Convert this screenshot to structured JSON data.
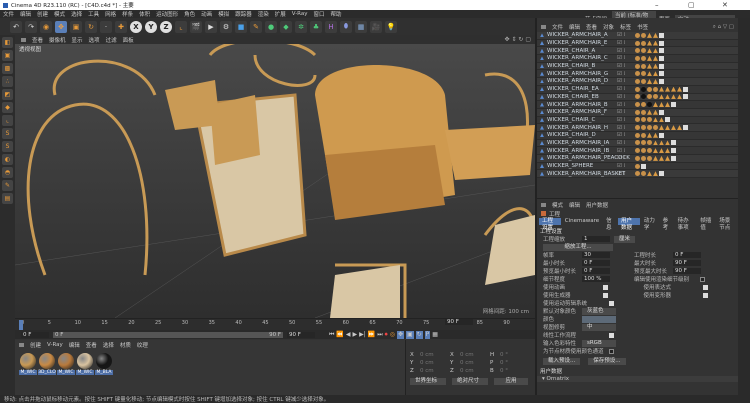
{
  "window": {
    "title": "Cinema 4D R23.110 (RC) - [C4D.c4d *] - 主要",
    "min": "–",
    "max": "▢",
    "close": "✕"
  },
  "menu": [
    "文件",
    "编辑",
    "创建",
    "模式",
    "选择",
    "工具",
    "网格",
    "样条",
    "体积",
    "运动图形",
    "角色",
    "动画",
    "模拟",
    "跟踪器",
    "渲染",
    "扩展",
    "V-Ray",
    "窗口",
    "帮助"
  ],
  "node_space": {
    "label": "节点空间:",
    "value": "当前 (标准/物理)",
    "layout_label": "界面:",
    "layout_value": "启动"
  },
  "toolbar": {
    "axis": [
      "X",
      "Y",
      "Z"
    ]
  },
  "viewport": {
    "menu": [
      "查看",
      "摄像机",
      "显示",
      "选项",
      "过滤",
      "面板"
    ],
    "label": "透视视图",
    "grid_text": "网格间距: 100 cm"
  },
  "object_manager": {
    "menu": [
      "文件",
      "编辑",
      "查看",
      "对象",
      "标签",
      "书签"
    ],
    "objects": [
      {
        "name": "WICKER_ARMCHAIR_A",
        "tags": "mmttx"
      },
      {
        "name": "WICKER_ARMCHAIR_E",
        "tags": "mmttx"
      },
      {
        "name": "WICKER_CHAIR_A",
        "tags": "mmttx"
      },
      {
        "name": "WICKER_ARMCHAIR_C",
        "tags": "mmttx"
      },
      {
        "name": "WICKER_CHAIR_B",
        "tags": "mmttx"
      },
      {
        "name": "WICKER_ARMCHAIR_G",
        "tags": "mmttx"
      },
      {
        "name": "WICKER_ARMCHAIR_D",
        "tags": "mmttx"
      },
      {
        "name": "WICKER_CHAIR_EA",
        "tags": "mdmmttttx"
      },
      {
        "name": "WICKER_CHAIR_EB",
        "tags": "mdmmttttx"
      },
      {
        "name": "WICKER_ARMCHAIR_B",
        "tags": "mmdtttx"
      },
      {
        "name": "WICKER_ARMCHAIR_F",
        "tags": "mmttx"
      },
      {
        "name": "WICKER_CHAIR_C",
        "tags": "mmmttx"
      },
      {
        "name": "WICKER_ARMCHAIR_H",
        "tags": "mmmmttttx"
      },
      {
        "name": "WICKER_CHAIR_D",
        "tags": "mmttx"
      },
      {
        "name": "WICKER_ARMCHAIR_IA",
        "tags": "mmmtttx"
      },
      {
        "name": "WICKER_ARMCHAIR_IB",
        "tags": "mmmtttx"
      },
      {
        "name": "WICKER_ARMCHAIR_PEACOCK",
        "tags": "mmmtttx"
      },
      {
        "name": "WICKER_SPHERE",
        "tags": "mx"
      },
      {
        "name": "WICKER_ARMCHAIR_BASKET",
        "tags": "mmttx"
      }
    ]
  },
  "attributes": {
    "menu": [
      "模式",
      "编辑",
      "用户数据"
    ],
    "object": "工程",
    "tabs": [
      "工程设置",
      "Cinemaware",
      "信息",
      "用户数据",
      "动力学",
      "参考",
      "待办事项",
      "帧插值",
      "场景节点"
    ],
    "section": "工程设置",
    "scale_label": "工程缩放",
    "scale_value": "1",
    "scale_unit": "厘米",
    "scale_btn": "缩放工程...",
    "fps_label": "帧率",
    "fps": "30",
    "time_label": "工程时长",
    "time": "0 F",
    "min_label": "最小时长",
    "min": "0 F",
    "max_label": "最大时长",
    "max": "90 F",
    "pmin_label": "预览最小时长",
    "pmin": "0 F",
    "pmax_label": "预览最大时长",
    "pmax": "90 F",
    "lod_label": "细节程度",
    "lod": "100 %",
    "lod_render_label": "编辑使用渲染细节级别",
    "anim_label": "使用动画",
    "expr_label": "使用表达式",
    "gen_label": "使用生成器",
    "deform_label": "使用变形器",
    "motion_label": "使用运动剪辑系统",
    "defcolor_label": "默认对象颜色",
    "defcolor": "灰蓝色",
    "color_label": "颜色",
    "view_clip_label": "视图修剪",
    "view_clip": "中",
    "linear_label": "线性工作流程",
    "input_color_label": "输入色彩特性",
    "input_color": "sRGB",
    "vertex_label": "为节点材质使用颜色通道",
    "load_btn": "载入预设...",
    "save_btn": "保存预设...",
    "user_data": "用户数据",
    "ornatrix": "▾ Ornatrix"
  },
  "timeline": {
    "ticks": [
      "0",
      "5",
      "10",
      "15",
      "20",
      "25",
      "30",
      "35",
      "40",
      "45",
      "50",
      "55",
      "60",
      "65",
      "70",
      "75",
      "80",
      "85",
      "90"
    ],
    "current": "0 F",
    "start": "0 F",
    "range_start": "0 F",
    "range_end": "90 F",
    "end": "90 F",
    "end_field": "90 F"
  },
  "materials": {
    "menu": [
      "创建",
      "V-Ray",
      "编辑",
      "查看",
      "选择",
      "材质",
      "纹理"
    ],
    "items": [
      {
        "label": "M_WIC",
        "color": "#c99a55"
      },
      {
        "label": "3D_CLO",
        "color": "#c88a45"
      },
      {
        "label": "M_WIC",
        "color": "#b97a3c"
      },
      {
        "label": "M_WIC",
        "color": "#d9c3a0"
      },
      {
        "label": "M_BLA",
        "color": "#151515"
      }
    ]
  },
  "coords": {
    "rows": [
      [
        "X",
        "0 cm",
        "X",
        "0 cm",
        "H",
        "0 °"
      ],
      [
        "Y",
        "0 cm",
        "Y",
        "0 cm",
        "P",
        "0 °"
      ],
      [
        "Z",
        "0 cm",
        "Z",
        "0 cm",
        "B",
        "0 °"
      ]
    ],
    "mode": "世界坐标",
    "size_mode": "绝对尺寸",
    "apply": "应用"
  },
  "status": "移动: 点击并拖动鼠标移动元素。按住 SHIFT 键量化移动; 节点编辑模式时按住 SHIFT 键增加选择对象; 按住 CTRL 键减少选择对象。"
}
